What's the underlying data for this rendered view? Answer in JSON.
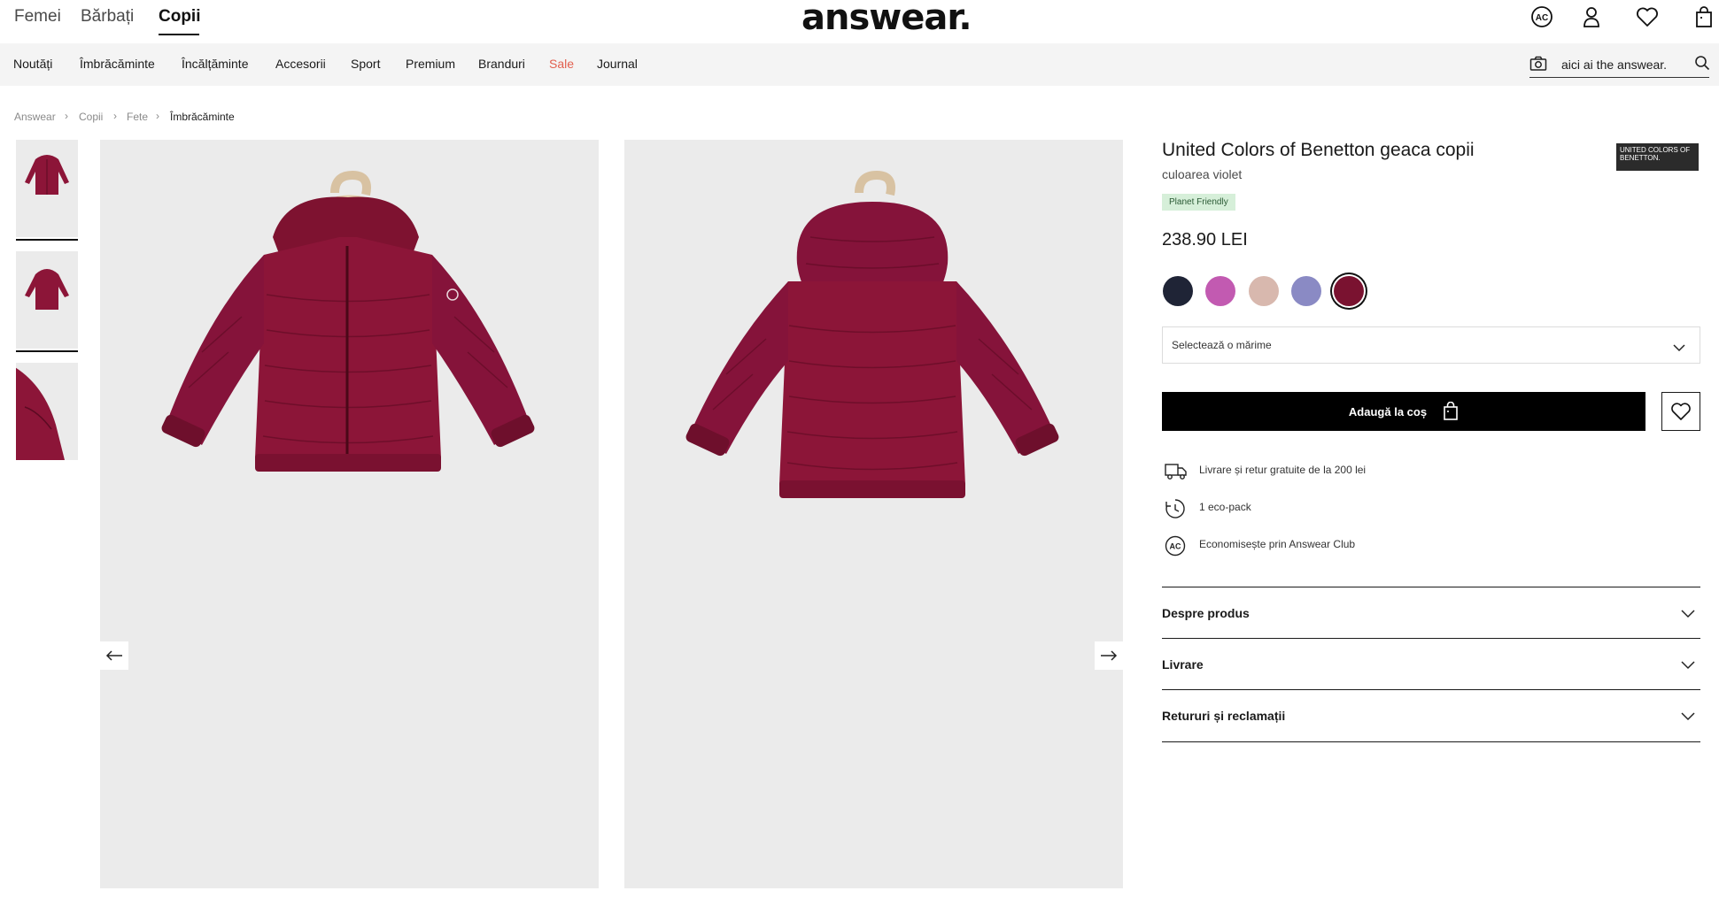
{
  "header": {
    "genders": [
      {
        "label": "Femei",
        "active": false
      },
      {
        "label": "Bărbați",
        "active": false
      },
      {
        "label": "Copii",
        "active": true
      }
    ],
    "logo": "answear.",
    "icons": [
      "answear-club-icon",
      "user-icon",
      "heart-icon",
      "shopping-bag-icon"
    ],
    "club_icon_text": "AC"
  },
  "nav": {
    "items": [
      "Noutăți",
      "Îmbrăcăminte",
      "Încălțăminte",
      "Accesorii",
      "Sport",
      "Premium",
      "Branduri",
      "Sale",
      "Journal"
    ],
    "sale_color": "#e2604f",
    "search_placeholder": "aici ai the answear."
  },
  "breadcrumb": [
    "Answear",
    "Copii",
    "Fete",
    "Îmbrăcăminte"
  ],
  "product": {
    "title": "United Colors of Benetton geaca copii",
    "color_label": "culoarea violet",
    "badge": "Planet Friendly",
    "brand_logo_text": "UNITED COLORS OF BENETTON.",
    "price": "238.90 LEI",
    "swatches": [
      {
        "color": "#1f2436",
        "selected": false
      },
      {
        "color": "#c25ab1",
        "selected": false
      },
      {
        "color": "#d8b8ae",
        "selected": false
      },
      {
        "color": "#8a8ac4",
        "selected": false
      },
      {
        "color": "#7a1230",
        "selected": true
      }
    ],
    "size_select_placeholder": "Selectează o mărime",
    "add_to_cart": "Adaugă la coș",
    "info": [
      {
        "icon": "delivery-truck-icon",
        "text": "Livrare și retur gratuite de la 200 lei"
      },
      {
        "icon": "eco-pack-icon",
        "text": "1 eco-pack"
      },
      {
        "icon": "answear-club-icon",
        "text": "Economisește prin Answear Club"
      }
    ],
    "accordions": [
      "Despre produs",
      "Livrare",
      "Retururi și reclamații"
    ]
  },
  "colors": {
    "jacket": "#8c1538",
    "jacket_dark": "#5c0a22",
    "badge_bg": "#d6efd9"
  }
}
